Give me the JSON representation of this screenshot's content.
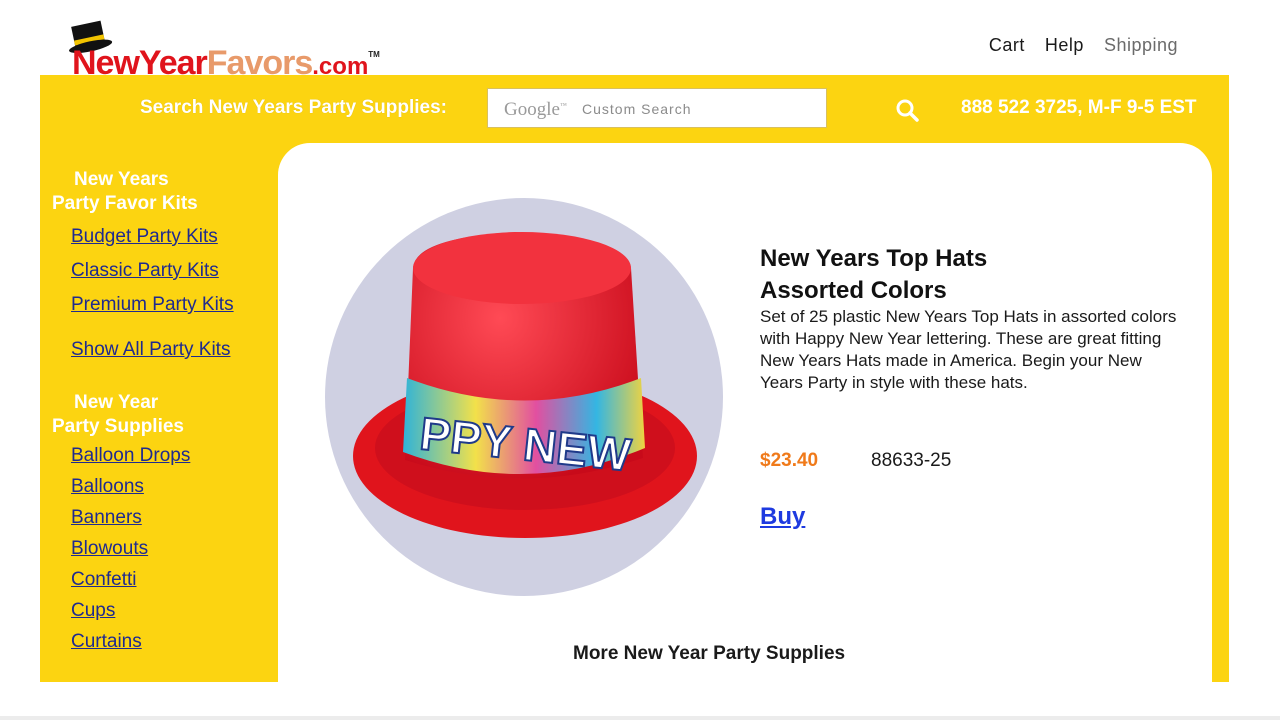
{
  "header": {
    "logo": {
      "part1": "NewYear",
      "part2": "Favors",
      "part3": ".com",
      "tm": "TM"
    },
    "nav": [
      "Cart",
      "Help",
      "Shipping"
    ]
  },
  "search": {
    "label": "Search New Years Party Supplies:",
    "brand": "Google",
    "brand_tm": "™",
    "placeholder": "Custom Search",
    "button_icon": "search-icon"
  },
  "phone": "888 522 3725, M-F 9-5 EST",
  "sidebar": {
    "sections": [
      {
        "heading_line1": "New Years",
        "heading_line2": "Party Favor Kits",
        "links": [
          "Budget Party Kits",
          "Classic Party Kits",
          "Premium Party Kits",
          "Show All Party Kits"
        ]
      },
      {
        "heading_line1": "New Year",
        "heading_line2": "Party Supplies",
        "links": [
          "Balloon Drops",
          "Balloons",
          "Banners",
          "Blowouts",
          "Confetti",
          "Cups",
          "Curtains"
        ]
      }
    ]
  },
  "product": {
    "title_line1": "New Years Top Hats",
    "title_line2": "Assorted Colors",
    "description": "Set of 25 plastic New Years Top Hats in assorted colors with Happy New Year lettering. These are great fitting New Years Hats made in America. Begin your New Years Party in style with these hats.",
    "price": "$23.40",
    "sku": "88633-25",
    "buy_label": "Buy",
    "hat_band_text": "PPY NEW"
  },
  "more_label": "More New Year Party Supplies",
  "colors": {
    "accent_yellow": "#fcd411",
    "logo_red": "#e0141c",
    "price_orange": "#f07a1a",
    "link_blue": "#1f2a8f"
  }
}
